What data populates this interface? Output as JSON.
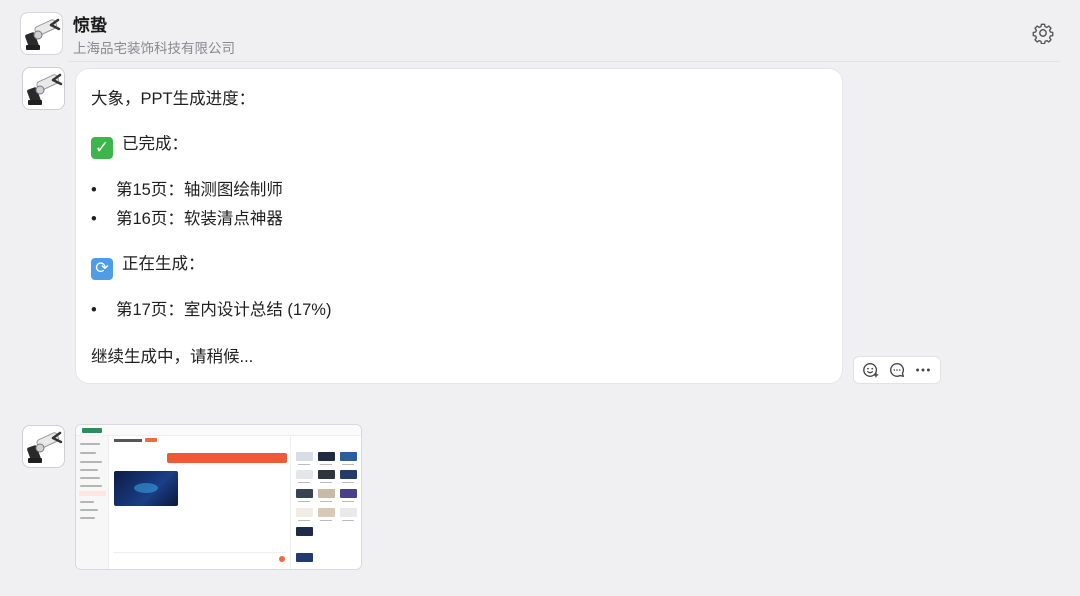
{
  "header": {
    "name": "惊蛰",
    "subtitle": "上海品宅装饰科技有限公司"
  },
  "message": {
    "greeting": "大象，PPT生成进度：",
    "done_heading": "已完成：",
    "done_items": [
      "第15页：轴测图绘制师",
      "第16页：软装清点神器"
    ],
    "progress_heading": "正在生成：",
    "progress_items": [
      "第17页：室内设计总结 (17%)"
    ],
    "footer": "继续生成中，请稍候..."
  },
  "actions": {
    "icons": [
      "add-reaction-icon",
      "reply-icon",
      "more-icon"
    ]
  },
  "attachment": {
    "type": "screenshot",
    "inner_tab_title": "PPT智能分析师"
  },
  "colors": {
    "accent_orange": "#ef5a33",
    "check_green": "#3cb64a",
    "cycle_blue": "#4f9de6",
    "background": "#f0f0f2"
  }
}
